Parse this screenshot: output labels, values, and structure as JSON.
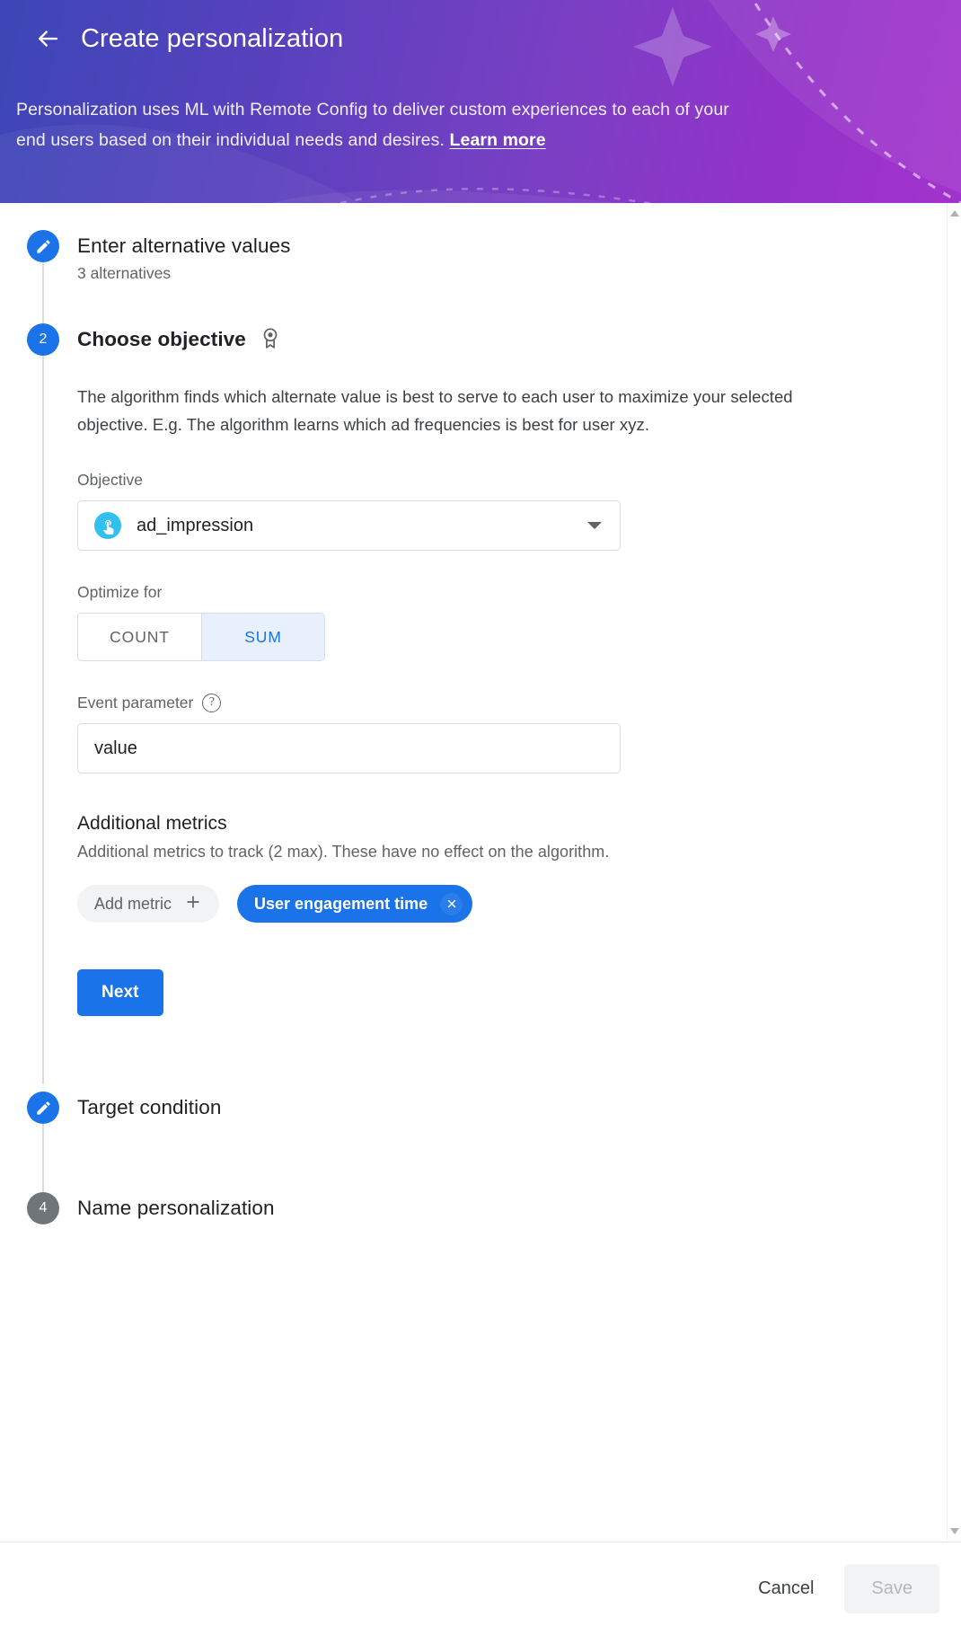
{
  "header": {
    "back_icon": "arrow-left-icon",
    "title": "Create personalization",
    "description_part1": "Personalization uses ML with Remote Config to deliver custom experiences to each of your end users based on their individual needs and desires. ",
    "learn_more": "Learn more",
    "gradient_from": "#3c46b6",
    "gradient_to": "#a233cc"
  },
  "steps": [
    {
      "marker": "edit-icon",
      "state": "done",
      "title": "Enter alternative values",
      "subtitle": "3 alternatives"
    },
    {
      "marker": "2",
      "state": "active",
      "title": "Choose objective",
      "title_icon": "award-badge-icon"
    },
    {
      "marker": "edit-icon",
      "state": "done",
      "title": "Target condition"
    },
    {
      "marker": "4",
      "state": "idle",
      "title": "Name personalization"
    }
  ],
  "objective_panel": {
    "description": "The algorithm finds which alternate value is best to serve to each user to maximize your selected objective. E.g. The algorithm learns which ad frequencies is best for user xyz.",
    "objective_label": "Objective",
    "objective_value": "ad_impression",
    "objective_icon": "touch-app-icon",
    "objective_icon_color": "#32c0f0",
    "dropdown_icon": "chevron-down-icon",
    "optimize_label": "Optimize for",
    "optimize_options": [
      "COUNT",
      "SUM"
    ],
    "optimize_selected": "SUM",
    "event_param_label": "Event parameter",
    "event_param_help_icon": "help-circle-icon",
    "event_param_value": "value",
    "additional_metrics_title": "Additional metrics",
    "additional_metrics_sub": "Additional metrics to track (2 max). These have no effect on the algorithm.",
    "add_metric_label": "Add metric",
    "add_metric_icon": "plus-icon",
    "selected_metric": "User engagement time",
    "selected_metric_remove_icon": "close-circle-icon",
    "next_label": "Next",
    "accent_color": "#1a73e8"
  },
  "scrollbar": {
    "up_icon": "scroll-up-arrow-icon",
    "down_icon": "scroll-down-arrow-icon"
  },
  "footer": {
    "cancel_label": "Cancel",
    "save_label": "Save"
  }
}
